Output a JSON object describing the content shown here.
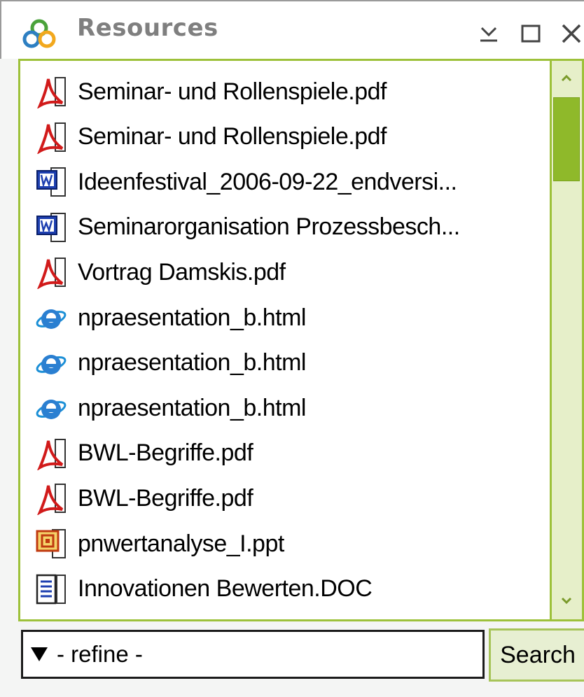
{
  "window": {
    "title": "Resources",
    "controls": [
      "minimize-icon",
      "maximize-icon",
      "close-icon"
    ]
  },
  "colors": {
    "accent_green": "#9dc13a",
    "scroll_thumb": "#8fb92a",
    "title_gray": "#7f7f7f"
  },
  "resources": [
    {
      "icon": "pdf-icon",
      "name": "Seminar- und Rollenspiele.pdf"
    },
    {
      "icon": "pdf-icon",
      "name": "Seminar- und Rollenspiele.pdf"
    },
    {
      "icon": "word-doc-icon",
      "name": "Ideenfestival_2006-09-22_endversi..."
    },
    {
      "icon": "word-doc-icon",
      "name": "Seminarorganisation Prozessbesch..."
    },
    {
      "icon": "pdf-icon",
      "name": "Vortrag Damskis.pdf"
    },
    {
      "icon": "html-ie-icon",
      "name": "npraesentation_b.html"
    },
    {
      "icon": "html-ie-icon",
      "name": "npraesentation_b.html"
    },
    {
      "icon": "html-ie-icon",
      "name": "npraesentation_b.html"
    },
    {
      "icon": "pdf-icon",
      "name": "BWL-Begriffe.pdf"
    },
    {
      "icon": "pdf-icon",
      "name": "BWL-Begriffe.pdf"
    },
    {
      "icon": "powerpoint-icon",
      "name": "pnwertanalyse_I.ppt"
    },
    {
      "icon": "text-doc-icon",
      "name": "Innovationen Bewerten.DOC"
    },
    {
      "icon": "powerpoint-icon",
      "name": ""
    }
  ],
  "refine": {
    "value": "- refine -"
  },
  "search": {
    "label": "Search"
  }
}
